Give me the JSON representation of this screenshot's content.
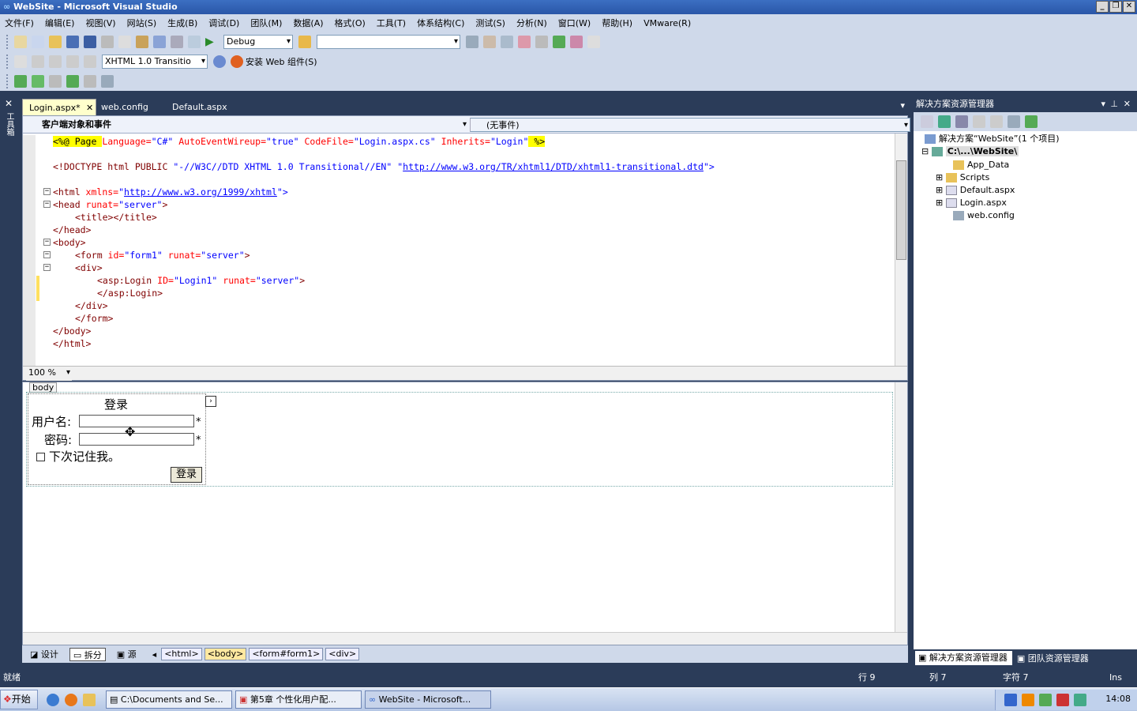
{
  "window": {
    "title": "WebSite - Microsoft Visual Studio"
  },
  "menu": [
    "文件(F)",
    "编辑(E)",
    "视图(V)",
    "网站(S)",
    "生成(B)",
    "调试(D)",
    "团队(M)",
    "数据(A)",
    "格式(O)",
    "工具(T)",
    "体系结构(C)",
    "测试(S)",
    "分析(N)",
    "窗口(W)",
    "帮助(H)",
    "VMware(R)"
  ],
  "toolbar": {
    "config": "Debug",
    "doctype": "XHTML 1.0 Transitio",
    "install_web": "安装 Web 组件(S)"
  },
  "tabs": [
    "Login.aspx*",
    "web.config",
    "Default.aspx"
  ],
  "editor": {
    "client_objects": "客户端对象和事件",
    "events": "(无事件)",
    "zoom": "100 %"
  },
  "code": {
    "l1": {
      "a": "<%@ Page ",
      "b": "Language=",
      "c": "\"C#\"",
      "d": " AutoEventWireup=",
      "e": "\"true\"",
      "f": " CodeFile=",
      "g": "\"Login.aspx.cs\"",
      "h": " Inherits=",
      "i": "\"Login\"",
      "j": " %>"
    },
    "l3": {
      "a": "<!DOCTYPE html PUBLIC ",
      "b": "\"-//W3C//DTD XHTML 1.0 Transitional//EN\"",
      "c": " \"",
      "d": "http://www.w3.org/TR/xhtml1/DTD/xhtml1-transitional.dtd",
      "e": "\">"
    },
    "l5": {
      "a": "<html ",
      "b": "xmlns=",
      "c": "\"",
      "d": "http://www.w3.org/1999/xhtml",
      "e": "\">"
    },
    "l6": {
      "a": "<head ",
      "b": "runat=",
      "c": "\"server\"",
      "d": ">"
    },
    "l7": "<title></title>",
    "l8": "</head>",
    "l9": "<body>",
    "l10": {
      "a": "<form ",
      "b": "id=",
      "c": "\"form1\"",
      "d": " runat=",
      "e": "\"server\"",
      "f": ">"
    },
    "l11": "<div>",
    "l12": {
      "a": "<asp:Login ",
      "b": "ID=",
      "c": "\"Login1\"",
      "d": " runat=",
      "e": "\"server\"",
      "f": ">"
    },
    "l13": "</asp:Login>",
    "l14": "</div>",
    "l15": "</form>",
    "l16": "</body>",
    "l17": "</html>"
  },
  "design": {
    "tag": "body",
    "login_title": "登录",
    "username_label": "用户名:",
    "password_label": "密码:",
    "remember": "下次记住我。",
    "login_button": "登录",
    "required_mark": "*"
  },
  "bottom": {
    "design": "设计",
    "split": "拆分",
    "source": "源",
    "crumbs": [
      "<html>",
      "<body>",
      "<form#form1>",
      "<div>"
    ]
  },
  "solution": {
    "title": "解决方案资源管理器",
    "solution_node": "解决方案“WebSite”(1 个项目)",
    "project": "C:\\...\\WebSite\\",
    "items": [
      "App_Data",
      "Scripts",
      "Default.aspx",
      "Login.aspx",
      "web.config"
    ],
    "tab1": "解决方案资源管理器",
    "tab2": "团队资源管理器"
  },
  "status": {
    "ready": "就绪",
    "line": "行 9",
    "col": "列 7",
    "char": "字符 7",
    "ins": "Ins"
  },
  "taskbar": {
    "start": "开始",
    "t1": "C:\\Documents and Se...",
    "t2": "第5章 个性化用户配...",
    "t3": "WebSite - Microsoft...",
    "clock": "14:08"
  },
  "colors": {
    "accent": "#2b3c59",
    "yellow_dir": "#ffff00"
  }
}
